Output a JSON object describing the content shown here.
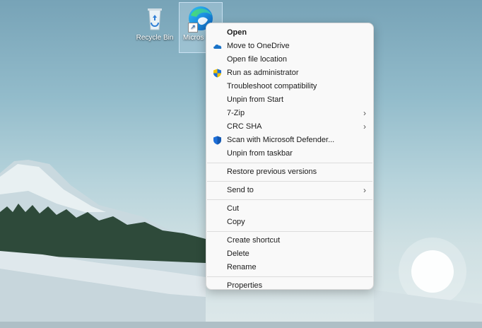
{
  "desktop": {
    "icons": [
      {
        "label": "Recycle Bin",
        "icon": "recycle-bin-icon"
      },
      {
        "label": "Microsoft Edge",
        "label_visible": "Micros Edg",
        "icon": "edge-icon"
      }
    ]
  },
  "context_menu": {
    "items": [
      {
        "label": "Open",
        "bold": true
      },
      {
        "label": "Move to OneDrive",
        "icon": "onedrive-icon"
      },
      {
        "label": "Open file location"
      },
      {
        "label": "Run as administrator",
        "icon": "uac-shield-icon"
      },
      {
        "label": "Troubleshoot compatibility"
      },
      {
        "label": "Unpin from Start"
      },
      {
        "label": "7-Zip",
        "submenu": true
      },
      {
        "label": "CRC SHA",
        "submenu": true
      },
      {
        "label": "Scan with Microsoft Defender...",
        "icon": "defender-shield-icon"
      },
      {
        "label": "Unpin from taskbar"
      },
      {
        "label": "Restore previous versions"
      },
      {
        "label": "Send to",
        "submenu": true
      },
      {
        "label": "Cut"
      },
      {
        "label": "Copy"
      },
      {
        "label": "Create shortcut"
      },
      {
        "label": "Delete"
      },
      {
        "label": "Rename"
      },
      {
        "label": "Properties"
      }
    ],
    "chevron": "›"
  },
  "colors": {
    "menu_bg": "#f9f9f9",
    "onedrive_blue": "#1a73c8",
    "shield_blue": "#1e6fd9",
    "shield_yellow": "#f2c200"
  }
}
